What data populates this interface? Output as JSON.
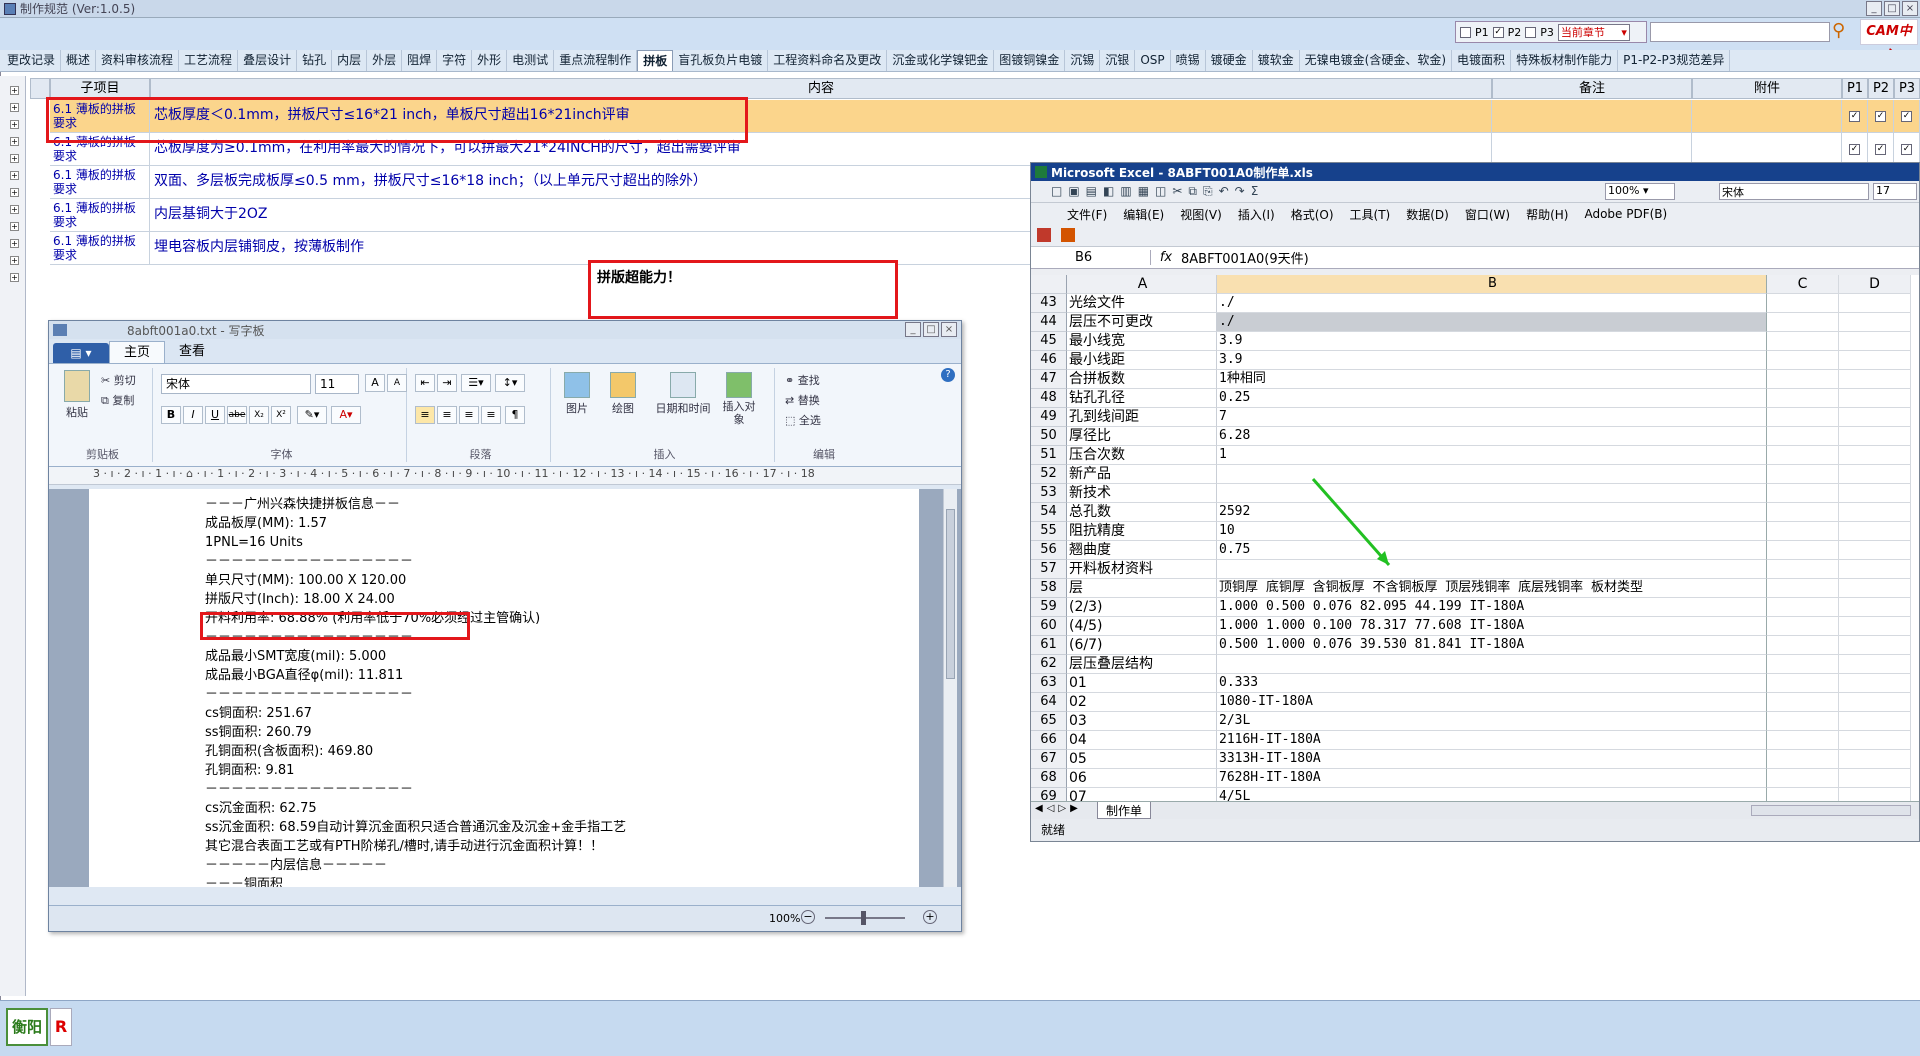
{
  "window": {
    "title": "制作规范 (Ver:1.0.5)"
  },
  "top_controls": {
    "p1_label": "P1",
    "p2_label": "P2",
    "p3_label": "P3",
    "chapter_select": "当前章节",
    "logo_text": "CAM中心"
  },
  "tabs": [
    "更改记录",
    "概述",
    "资料审核流程",
    "工艺流程",
    "叠层设计",
    "钻孔",
    "内层",
    "外层",
    "阻焊",
    "字符",
    "外形",
    "电测试",
    "重点流程制作",
    "拼板",
    "盲孔板负片电镀",
    "工程资料命名及更改",
    "沉金或化学镍钯金",
    "图镀铜镍金",
    "沉锡",
    "沉银",
    "OSP",
    "喷锡",
    "镀硬金",
    "镀软金",
    "无镍电镀金(含硬金、软金)",
    "电镀面积",
    "特殊板材制作能力",
    "P1-P2-P3规范差异"
  ],
  "active_tab": "拼板",
  "table": {
    "headers": {
      "sub": "子项目",
      "content": "内容",
      "note": "备注",
      "attach": "附件",
      "p1": "P1",
      "p2": "P2",
      "p3": "P3"
    },
    "rows": [
      {
        "sub": "6.1 薄板的拼板要求",
        "content": "芯板厚度＜0.1mm，拼板尺寸≤16*21 inch，单板尺寸超出16*21inch评审",
        "checks": [
          true,
          true,
          true
        ]
      },
      {
        "sub": "6.1 薄板的拼板要求",
        "content": "芯板厚度为≥0.1mm，在利用率最大的情况下，可以拼最大21*24INCH的尺寸，超出需要评审",
        "checks": [
          true,
          true,
          true
        ]
      },
      {
        "sub": "6.1 薄板的拼板要求",
        "content": "双面、多层板完成板厚≤0.5 mm，拼板尺寸≤16*18 inch；（以上单元尺寸超出的除外）",
        "checks": []
      },
      {
        "sub": "6.1 薄板的拼板要求",
        "content": "内层基铜大于2OZ",
        "checks": []
      },
      {
        "sub": "6.1 薄板的拼板要求",
        "content": "埋电容板内层铺铜皮，按薄板制作",
        "checks": []
      }
    ]
  },
  "callout": "拼版超能力！",
  "wordpad": {
    "title": "8abft001a0.txt - 写字板",
    "tabs": [
      "主页",
      "查看"
    ],
    "clipboard": {
      "paste": "粘贴",
      "cut": "剪切",
      "copy": "复制",
      "label": "剪贴板"
    },
    "font": {
      "name": "宋体",
      "size": "11",
      "label": "字体"
    },
    "paragraph_label": "段落",
    "insert": {
      "picture": "图片",
      "paint": "绘图",
      "datetime": "日期和时间",
      "object": "插入对象",
      "label": "插入"
    },
    "edit": {
      "find": "查找",
      "replace": "替换",
      "selectall": "全选",
      "label": "编辑"
    },
    "ruler": "3 · ı · 2 · ı · 1 · ı · ⌂ · ı · 1 · ı · 2 · ı · 3 · ı · 4 · ı · 5 · ı · 6 · ı · 7 · ı · 8 · ı · 9 · ı · 10 · ı · 11 · ı · 12 · ı · 13 · ı · 14 · ı · 15 · ı · 16 · ı · 17 · ı · 18",
    "lines": [
      "－－－广州兴森快捷拼板信息－－",
      "成品板厚(MM): 1.57",
      "1PNL=16 Units",
      "－－－－－－－－－－－－－－－－",
      "单只尺寸(MM): 100.00 X 120.00",
      "拼版尺寸(Inch): 18.00 X 24.00",
      "开料利用率: 68.88% (利用率低于70%必须经过主管确认)",
      "－－－－－－－－－－－－－－－－",
      "成品最小SMT宽度(mil): 5.000",
      "成品最小BGA直径φ(mil): 11.811",
      "－－－－－－－－－－－－－－－－",
      "cs铜面积: 251.67",
      "ss铜面积: 260.79",
      "孔铜面积(含板面积): 469.80",
      "孔铜面积: 9.81",
      "－－－－－－－－－－－－－－－－",
      "cs沉金面积: 62.75",
      "ss沉金面积: 68.59自动计算沉金面积只适合普通沉金及沉金+金手指工艺",
      "其它混合表面工艺或有PTH阶梯孔/槽时,请手动进行沉金面积计算！！",
      "－－－－－内层信息－－－－－",
      "－－－铜面积"
    ],
    "zoom": "100%"
  },
  "excel": {
    "title": "Microsoft Excel - 8ABFT001A0制作单.xls",
    "menu": [
      "文件(F)",
      "编辑(E)",
      "视图(V)",
      "插入(I)",
      "格式(O)",
      "工具(T)",
      "数据(D)",
      "窗口(W)",
      "帮助(H)",
      "Adobe PDF(B)"
    ],
    "zoom": "100%",
    "font": "宋体",
    "font_size": "17",
    "cell_ref": "B6",
    "formula": "8ABFT001A0(9天件)",
    "columns": [
      "A",
      "B",
      "C",
      "D"
    ],
    "rows": [
      {
        "n": "43",
        "a": "光绘文件",
        "b": "./"
      },
      {
        "n": "44",
        "a": "层压不可更改",
        "b": "./"
      },
      {
        "n": "45",
        "a": "最小线宽",
        "b": "3.9"
      },
      {
        "n": "46",
        "a": "最小线距",
        "b": "3.9"
      },
      {
        "n": "47",
        "a": "合拼板数",
        "b": "1种相同"
      },
      {
        "n": "48",
        "a": "钻孔孔径",
        "b": "0.25"
      },
      {
        "n": "49",
        "a": "孔到线间距",
        "b": "7"
      },
      {
        "n": "50",
        "a": "厚径比",
        "b": "6.28"
      },
      {
        "n": "51",
        "a": "压合次数",
        "b": "1"
      },
      {
        "n": "52",
        "a": "新产品",
        "b": ""
      },
      {
        "n": "53",
        "a": "新技术",
        "b": ""
      },
      {
        "n": "54",
        "a": "总孔数",
        "b": "2592"
      },
      {
        "n": "55",
        "a": "阻抗精度",
        "b": "10"
      },
      {
        "n": "56",
        "a": "翘曲度",
        "b": "0.75"
      },
      {
        "n": "57",
        "a": "开料板材资料",
        "b": ""
      },
      {
        "n": "58",
        "a": "层",
        "b": "顶铜厚 底铜厚 含铜板厚 不含铜板厚 顶层残铜率 底层残铜率 板材类型"
      },
      {
        "n": "59",
        "a": "(2/3)",
        "b": "1.000  0.500        0.076    82.095   44.199   IT-180A"
      },
      {
        "n": "60",
        "a": "(4/5)",
        "b": "1.000  1.000        0.100    78.317   77.608   IT-180A"
      },
      {
        "n": "61",
        "a": "(6/7)",
        "b": "0.500  1.000        0.076    39.530   81.841   IT-180A"
      },
      {
        "n": "62",
        "a": "层压叠层结构",
        "b": ""
      },
      {
        "n": "63",
        "a": "01",
        "b": "0.333"
      },
      {
        "n": "64",
        "a": "02",
        "b": "1080-IT-180A"
      },
      {
        "n": "65",
        "a": "03",
        "b": "2/3L"
      },
      {
        "n": "66",
        "a": "04",
        "b": "2116H-IT-180A"
      },
      {
        "n": "67",
        "a": "05",
        "b": "3313H-IT-180A"
      },
      {
        "n": "68",
        "a": "06",
        "b": "7628H-IT-180A"
      },
      {
        "n": "69",
        "a": "07",
        "b": "4/5L"
      }
    ],
    "sheet_tab": "制作单",
    "status": "就绪"
  },
  "bottom": {
    "city": "衡阳",
    "badge": "R"
  }
}
